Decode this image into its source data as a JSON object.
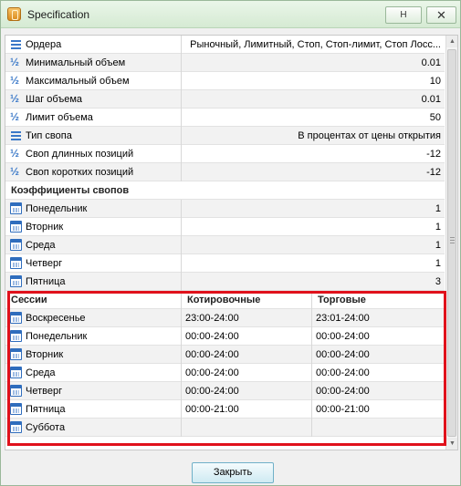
{
  "window": {
    "title": "Specification",
    "help_label": "H",
    "close_glyph": "✕"
  },
  "properties": [
    {
      "icon": "list-icon",
      "label": "Ордера",
      "value": "Рыночный, Лимитный, Стоп, Стоп-лимит, Стоп Лосс..."
    },
    {
      "icon": "half-icon",
      "label": "Минимальный объем",
      "value": "0.01"
    },
    {
      "icon": "half-icon",
      "label": "Максимальный объем",
      "value": "10"
    },
    {
      "icon": "half-icon",
      "label": "Шаг объема",
      "value": "0.01"
    },
    {
      "icon": "half-icon",
      "label": "Лимит объема",
      "value": "50"
    },
    {
      "icon": "list-icon",
      "label": "Тип свопа",
      "value": "В процентах от цены открытия"
    },
    {
      "icon": "half-icon",
      "label": "Своп длинных позиций",
      "value": "-12"
    },
    {
      "icon": "half-icon",
      "label": "Своп коротких позиций",
      "value": "-12"
    }
  ],
  "swap_coefficients": {
    "header": "Коэффициенты свопов",
    "rows": [
      {
        "icon": "calendar-icon",
        "label": "Понедельник",
        "value": "1"
      },
      {
        "icon": "calendar-icon",
        "label": "Вторник",
        "value": "1"
      },
      {
        "icon": "calendar-icon",
        "label": "Среда",
        "value": "1"
      },
      {
        "icon": "calendar-icon",
        "label": "Четверг",
        "value": "1"
      },
      {
        "icon": "calendar-icon",
        "label": "Пятница",
        "value": "3"
      }
    ]
  },
  "sessions": {
    "headers": [
      "Сессии",
      "Котировочные",
      "Торговые"
    ],
    "rows": [
      {
        "icon": "calendar-icon",
        "day": "Воскресенье",
        "quote": "23:00-24:00",
        "trade": "23:01-24:00"
      },
      {
        "icon": "calendar-icon",
        "day": "Понедельник",
        "quote": "00:00-24:00",
        "trade": "00:00-24:00"
      },
      {
        "icon": "calendar-icon",
        "day": "Вторник",
        "quote": "00:00-24:00",
        "trade": "00:00-24:00"
      },
      {
        "icon": "calendar-icon",
        "day": "Среда",
        "quote": "00:00-24:00",
        "trade": "00:00-24:00"
      },
      {
        "icon": "calendar-icon",
        "day": "Четверг",
        "quote": "00:00-24:00",
        "trade": "00:00-24:00"
      },
      {
        "icon": "calendar-icon",
        "day": "Пятница",
        "quote": "00:00-21:00",
        "trade": "00:00-21:00"
      },
      {
        "icon": "calendar-icon",
        "day": "Суббота",
        "quote": "",
        "trade": ""
      }
    ]
  },
  "footer": {
    "close_label": "Закрыть"
  },
  "colors": {
    "highlight_border": "#e0111b",
    "icon_blue": "#3a78c8"
  }
}
